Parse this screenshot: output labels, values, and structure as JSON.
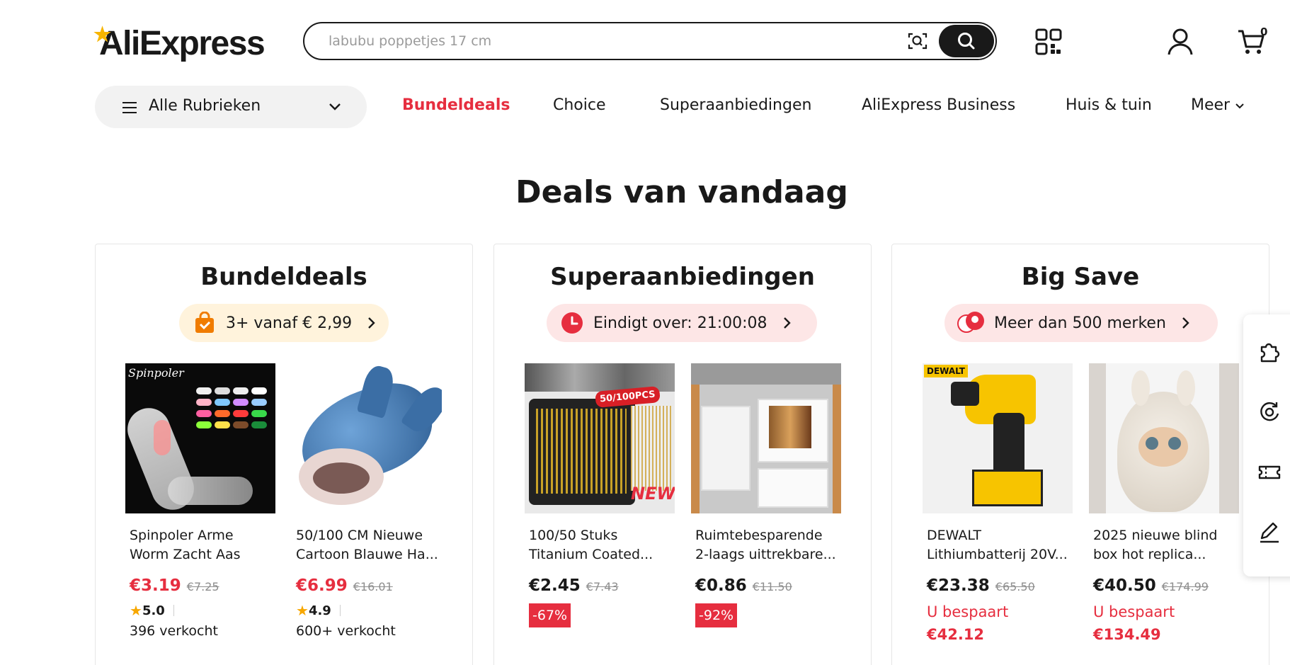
{
  "header": {
    "logo_text": "AliExpress",
    "search": {
      "placeholder": "labubu poppetjes 17 cm",
      "value": ""
    },
    "icons": [
      "camera-search-icon",
      "search-icon",
      "qr-code-icon",
      "belgium-flag-icon",
      "account-icon",
      "cart-icon"
    ],
    "cart_count": "0"
  },
  "nav": {
    "categories_label": "Alle Rubrieken",
    "links": [
      "Bundeldeals",
      "Choice",
      "Superaanbiedingen",
      "AliExpress Business",
      "Huis & tuin",
      "Meer"
    ],
    "active": "Bundeldeals"
  },
  "page_title": "Deals van vandaag",
  "colors": {
    "accent_red": "#e62e3f",
    "text": "#191919",
    "bundle_pill": "#fff3dc",
    "super_pill": "#fde6e6"
  },
  "cards": [
    {
      "title": "Bundeldeals",
      "pill": "3+ vanaf € 2,99",
      "products": [
        {
          "name": "Spinpoler Arme Worm Zacht Aas Tp...",
          "price": "€3.19",
          "old_price": "€7.25",
          "rating": "5.0",
          "sold": "396 verkocht",
          "brand_text": "Spinpoler"
        },
        {
          "name": "50/100 CM Nieuwe Cartoon Blauwe Ha...",
          "price": "€6.99",
          "old_price": "€16.01",
          "rating": "4.9",
          "sold": "600+ verkocht"
        }
      ]
    },
    {
      "title": "Superaanbiedingen",
      "pill": "Eindigt over: 21:00:08",
      "products": [
        {
          "name": "100/50 Stuks Titanium Coated...",
          "price": "€2.45",
          "old_price": "€7.43",
          "discount": "-67%",
          "img_badge": "50/100PCS",
          "img_new": "NEW"
        },
        {
          "name": "Ruimtebesparende 2-laags uittrekbare...",
          "price": "€0.86",
          "old_price": "€11.50",
          "discount": "-92%"
        }
      ]
    },
    {
      "title": "Big Save",
      "pill": "Meer dan 500 merken",
      "products": [
        {
          "name": "DEWALT Lithiumbatterij 20V...",
          "price": "€23.38",
          "old_price": "€65.50",
          "save_label": "U bespaart",
          "save_amount": "€42.12",
          "brand_text": "DEWALT"
        },
        {
          "name": "2025 nieuwe blind box hot replica...",
          "price": "€40.50",
          "old_price": "€174.99",
          "save_label": "U bespaart",
          "save_amount": "€134.49"
        }
      ]
    }
  ],
  "rail_icons": [
    "puzzle-icon",
    "refresh-icon",
    "coupon-icon",
    "edit-icon"
  ]
}
